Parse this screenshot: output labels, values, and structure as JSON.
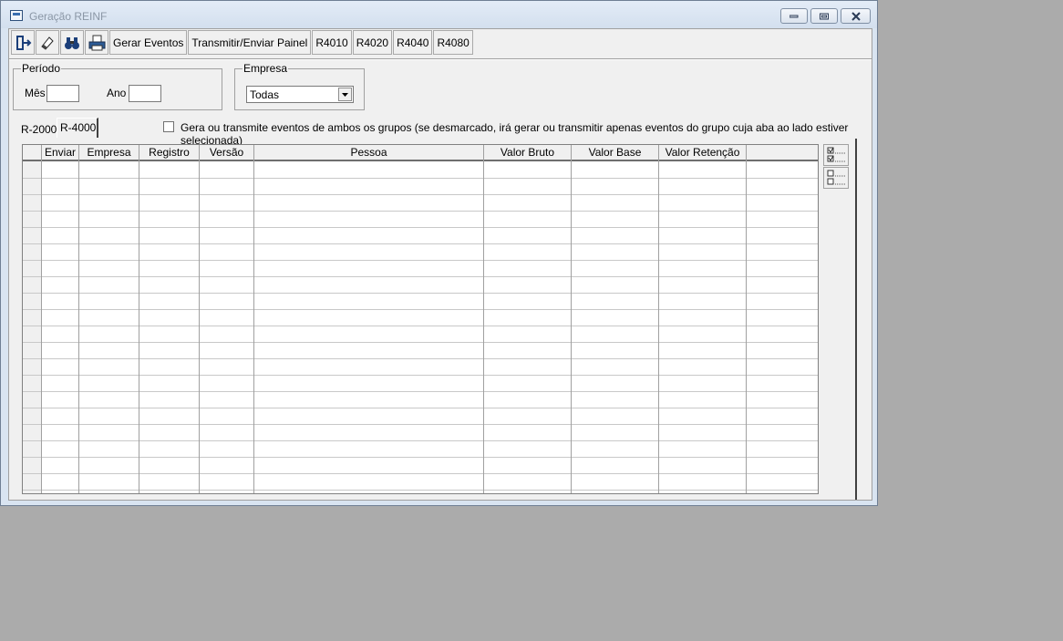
{
  "window": {
    "title": "Geração REINF"
  },
  "toolbar": {
    "icons": [
      "exit-icon",
      "eraser-icon",
      "binoculars-icon",
      "printer-icon"
    ],
    "buttons": [
      "Gerar Eventos",
      "Transmitir/Enviar Painel",
      "R4010",
      "R4020",
      "R4040",
      "R4080"
    ]
  },
  "periodo": {
    "legend": "Período",
    "mes_label": "Mês",
    "ano_label": "Ano",
    "mes_value": "",
    "ano_value": ""
  },
  "empresa": {
    "legend": "Empresa",
    "selected": "Todas"
  },
  "tabs": {
    "items": [
      "R-2000",
      "R-4000"
    ],
    "active": "R-4000"
  },
  "both_groups": {
    "checked": false,
    "label": "Gera ou transmite eventos de ambos os grupos (se desmarcado, irá gerar ou transmitir apenas eventos do grupo cuja aba ao lado estiver selecionada)"
  },
  "grid": {
    "columns": [
      "Enviar",
      "Empresa",
      "Registro",
      "Versão",
      "Pessoa",
      "Valor Bruto",
      "Valor Base",
      "Valor Retenção"
    ],
    "rows": []
  },
  "side_buttons": [
    "check-all-icon",
    "uncheck-all-icon"
  ]
}
